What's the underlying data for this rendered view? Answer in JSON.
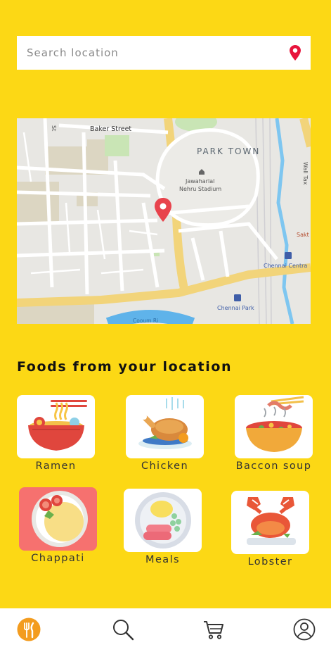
{
  "search": {
    "placeholder": "Search location",
    "value": "",
    "icon": "map-pin-icon",
    "icon_color": "#E8143C"
  },
  "map": {
    "labels": {
      "baker_street": "Baker Street",
      "park_town": "PARK TOWN",
      "stadium_line1": "Jawaharlal",
      "stadium_line2": "Nehru Stadium",
      "chennai_central": "Chennai Centra",
      "chennai_park": "Chennai Park",
      "cooum": "Cooum Ri",
      "wall": "Wall Tax",
      "sakt": "Sakt",
      "st": "St"
    },
    "marker_color": "#E8434C"
  },
  "section": {
    "title": "Foods from your location"
  },
  "foods": [
    {
      "label": "Ramen",
      "icon": "ramen-bowl-icon",
      "selected": false
    },
    {
      "label": "Chicken",
      "icon": "roast-chicken-icon",
      "selected": false
    },
    {
      "label": "Baccon soup",
      "icon": "bacon-soup-icon",
      "selected": false
    },
    {
      "label": "Chappati",
      "icon": "chappati-plate-icon",
      "selected": true
    },
    {
      "label": "Meals",
      "icon": "meals-plate-icon",
      "selected": false
    },
    {
      "label": "Lobster",
      "icon": "lobster-icon",
      "selected": false
    }
  ],
  "nav": {
    "items": [
      {
        "name": "restaurant",
        "icon": "fork-knife-icon",
        "active": true
      },
      {
        "name": "search",
        "icon": "search-icon",
        "active": false
      },
      {
        "name": "cart",
        "icon": "cart-icon",
        "active": false
      },
      {
        "name": "profile",
        "icon": "user-icon",
        "active": false
      }
    ],
    "active_color": "#F39C1F"
  },
  "colors": {
    "background": "#FCD815",
    "selected_tile": "#F6716F"
  }
}
